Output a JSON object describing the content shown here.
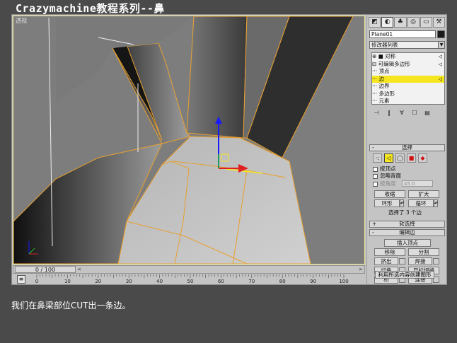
{
  "page_title": "Crazymachine教程系列--鼻",
  "viewport": {
    "label": "透视"
  },
  "timeline": {
    "position": "0 / 100",
    "prev": "<",
    "next": ">"
  },
  "ruler": {
    "ticks": [
      "0",
      "10",
      "20",
      "30",
      "40",
      "50",
      "60",
      "70",
      "80",
      "90",
      "100"
    ]
  },
  "panel": {
    "tabs": [
      "create",
      "modify",
      "hierarchy",
      "motion",
      "display",
      "utilities"
    ],
    "object_name": "Plane01",
    "object_color": "#1a1a1a",
    "modifier_list": "修改器列表",
    "stack": [
      {
        "label": "⊕ ■ 对称",
        "arrow": "◁",
        "selected": false
      },
      {
        "label": "⊟ 可编辑多边形",
        "arrow": "◁",
        "selected": false
      },
      {
        "label": "··· 顶点",
        "arrow": "",
        "selected": false
      },
      {
        "label": "··· 边",
        "arrow": "◁",
        "selected": true
      },
      {
        "label": "··· 边界",
        "arrow": "",
        "selected": false
      },
      {
        "label": "··· 多边形",
        "arrow": "",
        "selected": false
      },
      {
        "label": "··· 元素",
        "arrow": "",
        "selected": false
      }
    ],
    "selection": {
      "title": "选择",
      "by_vertex": "按顶点",
      "ignore_backfacing": "忽略背面",
      "by_angle": "按角度",
      "angle_value": "45.0",
      "shrink": "收缩",
      "grow": "扩大",
      "ring": "环形",
      "loop": "循环",
      "status": "选择了 3 个边"
    },
    "soft_selection": {
      "title": "软选择"
    },
    "edit_edges": {
      "title": "编辑边",
      "insert_vertex": "插入顶点",
      "remove": "移除",
      "split": "分割",
      "extrude": "挤出",
      "weld": "焊接",
      "chamfer": "切角",
      "target_weld": "目标焊接",
      "bridge": "桥",
      "connect": "连接",
      "create_shape": "利用所选内容创建图形"
    },
    "accent_color": "#f5e61f"
  },
  "caption": "我们在鼻梁部位CUT出一条边。"
}
